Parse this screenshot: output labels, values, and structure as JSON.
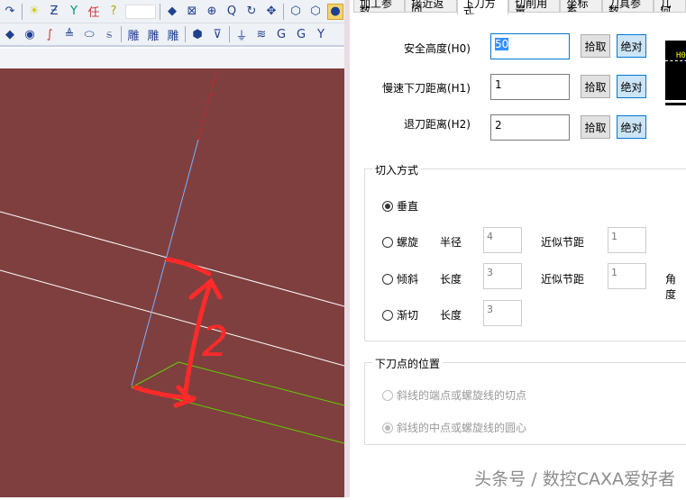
{
  "toolbar": {
    "row1": [
      "redo-icon",
      "light-icon",
      "zigzag-icon",
      "filter-icon",
      "task-icon",
      "help-icon",
      "color-box",
      "pan-view-icon",
      "zoom-window-icon",
      "zoom-in-icon",
      "zoom-dyn-icon",
      "rotate-icon",
      "move-icon",
      "shaded-icon",
      "wire-icon"
    ],
    "row2": [
      "sweep-icon",
      "surface-icon",
      "curve-icon",
      "stack-icon",
      "disk-icon",
      "cup-icon",
      "engrave-e-icon",
      "engrave-y-icon",
      "engrave-s-icon",
      "cube-icon",
      "cup2-icon",
      "g01-icon",
      "flow-icon",
      "gcode-icon",
      "gdrill-icon",
      "tool-icon"
    ]
  },
  "tabs": [
    "加工参数",
    "接近返回",
    "下刀方式",
    "切削用量",
    "坐标系",
    "刀具参数",
    "几何"
  ],
  "active_tab": "下刀方式",
  "fields": [
    {
      "label": "安全高度(H0)",
      "value": "50",
      "pick": "拾取",
      "mode": "绝对"
    },
    {
      "label": "慢速下刀距离(H1)",
      "value": "1",
      "pick": "拾取",
      "mode": "绝对"
    },
    {
      "label": "退刀距离(H2)",
      "value": "2",
      "pick": "拾取",
      "mode": "绝对"
    }
  ],
  "preview_label": "H0",
  "cut_in": {
    "title": "切入方式",
    "options": [
      {
        "label": "垂直",
        "checked": true
      },
      {
        "label": "螺旋",
        "p1": "半径",
        "v1": "4",
        "p2": "近似节距",
        "v2": "1"
      },
      {
        "label": "倾斜",
        "p1": "长度",
        "v1": "3",
        "p2": "近似节距",
        "v2": "1",
        "p3": "角度"
      },
      {
        "label": "渐切",
        "p1": "长度",
        "v1": "3"
      }
    ]
  },
  "plunge_pos": {
    "title": "下刀点的位置",
    "options": [
      {
        "label": "斜线的端点或螺旋线的切点",
        "checked": false
      },
      {
        "label": "斜线的中点或螺旋线的圆心",
        "checked": true
      }
    ]
  },
  "annotation": "2",
  "watermark": "头条号 / 数控CAXA爱好者",
  "colors": {
    "viewport": "#7f3f3f",
    "accent": "#0078d7"
  }
}
